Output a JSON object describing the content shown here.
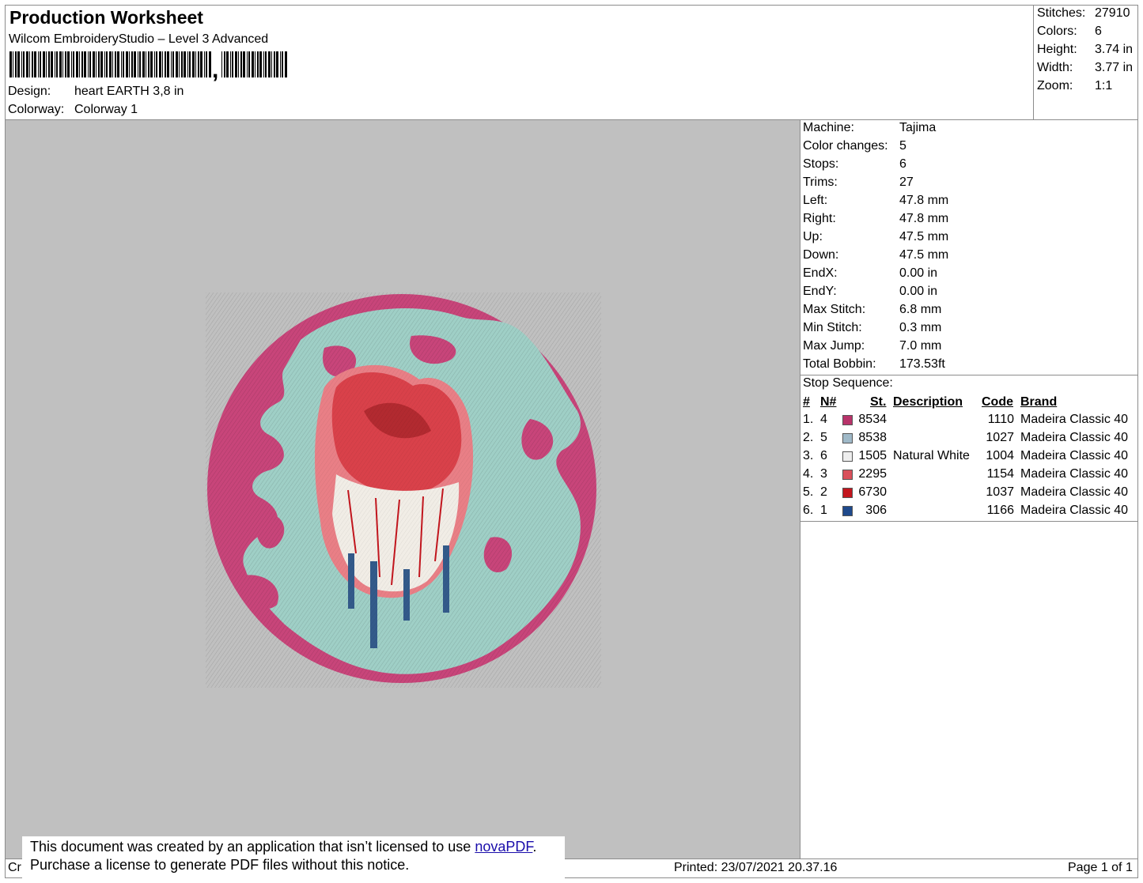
{
  "header": {
    "title": "Production Worksheet",
    "software": "Wilcom EmbroideryStudio – Level 3 Advanced",
    "barcode_comma": ",",
    "design_label": "Design:",
    "design_value": "heart EARTH 3,8 in",
    "colorway_label": "Colorway:",
    "colorway_value": "Colorway 1"
  },
  "summary": {
    "stitches_label": "Stitches:",
    "stitches_value": "27910",
    "colors_label": "Colors:",
    "colors_value": "6",
    "height_label": "Height:",
    "height_value": "3.74 in",
    "width_label": "Width:",
    "width_value": "3.77 in",
    "zoom_label": "Zoom:",
    "zoom_value": "1:1"
  },
  "machine_info": [
    {
      "label": "Machine:",
      "value": "Tajima"
    },
    {
      "label": "Color changes:",
      "value": "5"
    },
    {
      "label": "Stops:",
      "value": "6"
    },
    {
      "label": "Trims:",
      "value": "27"
    },
    {
      "label": "Left:",
      "value": "47.8 mm"
    },
    {
      "label": "Right:",
      "value": "47.8 mm"
    },
    {
      "label": "Up:",
      "value": "47.5 mm"
    },
    {
      "label": "Down:",
      "value": "47.5 mm"
    },
    {
      "label": "EndX:",
      "value": "0.00 in"
    },
    {
      "label": "EndY:",
      "value": "0.00 in"
    },
    {
      "label": "Max Stitch:",
      "value": "6.8 mm"
    },
    {
      "label": "Min Stitch:",
      "value": "0.3 mm"
    },
    {
      "label": "Max Jump:",
      "value": "7.0 mm"
    },
    {
      "label": "Total Bobbin:",
      "value": "173.53ft"
    }
  ],
  "stop_sequence": {
    "title": "Stop Sequence:",
    "headers": {
      "num": "#",
      "n": "N#",
      "st": "St.",
      "description": "Description",
      "code": "Code",
      "brand": "Brand"
    },
    "rows": [
      {
        "num": "1.",
        "n": "4",
        "color": "#b8336a",
        "st": "8534",
        "description": "",
        "code": "1110",
        "brand": "Madeira Classic 40"
      },
      {
        "num": "2.",
        "n": "5",
        "color": "#9fb9c8",
        "st": "8538",
        "description": "",
        "code": "1027",
        "brand": "Madeira Classic 40"
      },
      {
        "num": "3.",
        "n": "6",
        "color": "#eeeeee",
        "st": "1505",
        "description": "Natural White",
        "code": "1004",
        "brand": "Madeira Classic 40"
      },
      {
        "num": "4.",
        "n": "3",
        "color": "#d9505b",
        "st": "2295",
        "description": "",
        "code": "1154",
        "brand": "Madeira Classic 40"
      },
      {
        "num": "5.",
        "n": "2",
        "color": "#c3161e",
        "st": "6730",
        "description": "",
        "code": "1037",
        "brand": "Madeira Classic 40"
      },
      {
        "num": "6.",
        "n": "1",
        "color": "#1f4a8c",
        "st": "306",
        "description": "",
        "code": "1166",
        "brand": "Madeira Classic 40"
      }
    ]
  },
  "footer": {
    "cut_text": "Cr",
    "printed": "Printed: 23/07/2021 20.37.16",
    "page": "Page 1 of 1"
  },
  "notice": {
    "line1_prefix": "This document was created by an application that isn’t licensed to use ",
    "link": "novaPDF",
    "line1_suffix": ".",
    "line2": "Purchase a license to generate PDF files without this notice."
  },
  "colors": {
    "canvas_bg": "#c0c0c0",
    "pink": "#c8457a",
    "teal": "#9fcfc6",
    "heart_red": "#d9414a",
    "heart_dark": "#b22a30",
    "vein_blue": "#335a8a",
    "white_thread": "#f1ede6"
  }
}
